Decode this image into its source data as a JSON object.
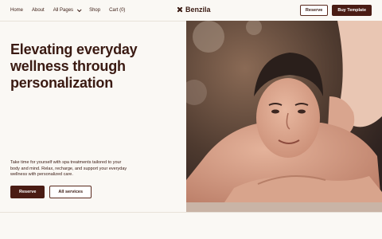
{
  "nav": {
    "links": [
      "Home",
      "About",
      "All Pages",
      "Shop",
      "Cart (0)"
    ],
    "brand": "Benzila",
    "reserve_label": "Reserve",
    "buy_label": "Buy Template"
  },
  "hero": {
    "headline": "Elevating everyday wellness through personalization",
    "description": "Take time for yourself with spa treatments tailored to your body and mind. Relax, recharge, and support your everyday wellness with personalized care.",
    "primary_cta": "Reserve",
    "secondary_cta": "All services"
  },
  "colors": {
    "brand": "#4a1c14",
    "background": "#faf8f4",
    "text": "#3a1a12"
  },
  "icons": {
    "brand_mark": "x-mark-icon",
    "dropdown": "chevron-down-icon"
  }
}
